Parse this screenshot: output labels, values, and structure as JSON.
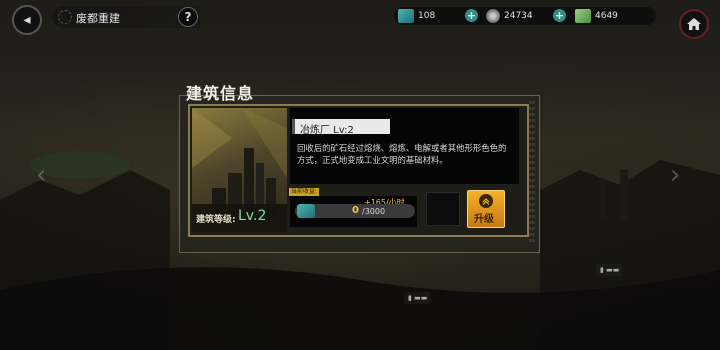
{
  "top_bar": {
    "title": "废都重建",
    "help_label": "?",
    "back_icon": "back-arrow-icon",
    "home_icon": "home-icon"
  },
  "resources": [
    {
      "icon": "data-chip-icon",
      "value": "108",
      "color": "#4fb3b3"
    },
    {
      "icon": "gear-coin-icon",
      "value": "24734",
      "color": "#9a9a9a"
    },
    {
      "icon": "cash-icon",
      "value": "4649",
      "color": "#7fbf6a"
    }
  ],
  "dialog": {
    "title": "建筑信息",
    "building": {
      "name": "冶炼厂 Lv:2",
      "level_label": "建筑等级:",
      "level_value": "Lv.2",
      "description": "回收后的矿石经过熔烧、熔炼、电解或者其他形形色色的方式，正式地变成工业文明的基础材料。"
    },
    "income": {
      "tag": "当前收益:",
      "rate": "+165/小时",
      "current": "0",
      "max": "/3000"
    },
    "upgrade_label": "升级"
  },
  "colors": {
    "accent_gold": "#f0c44a",
    "level_green": "#7fe0a0",
    "frame": "#8a7d4f"
  }
}
